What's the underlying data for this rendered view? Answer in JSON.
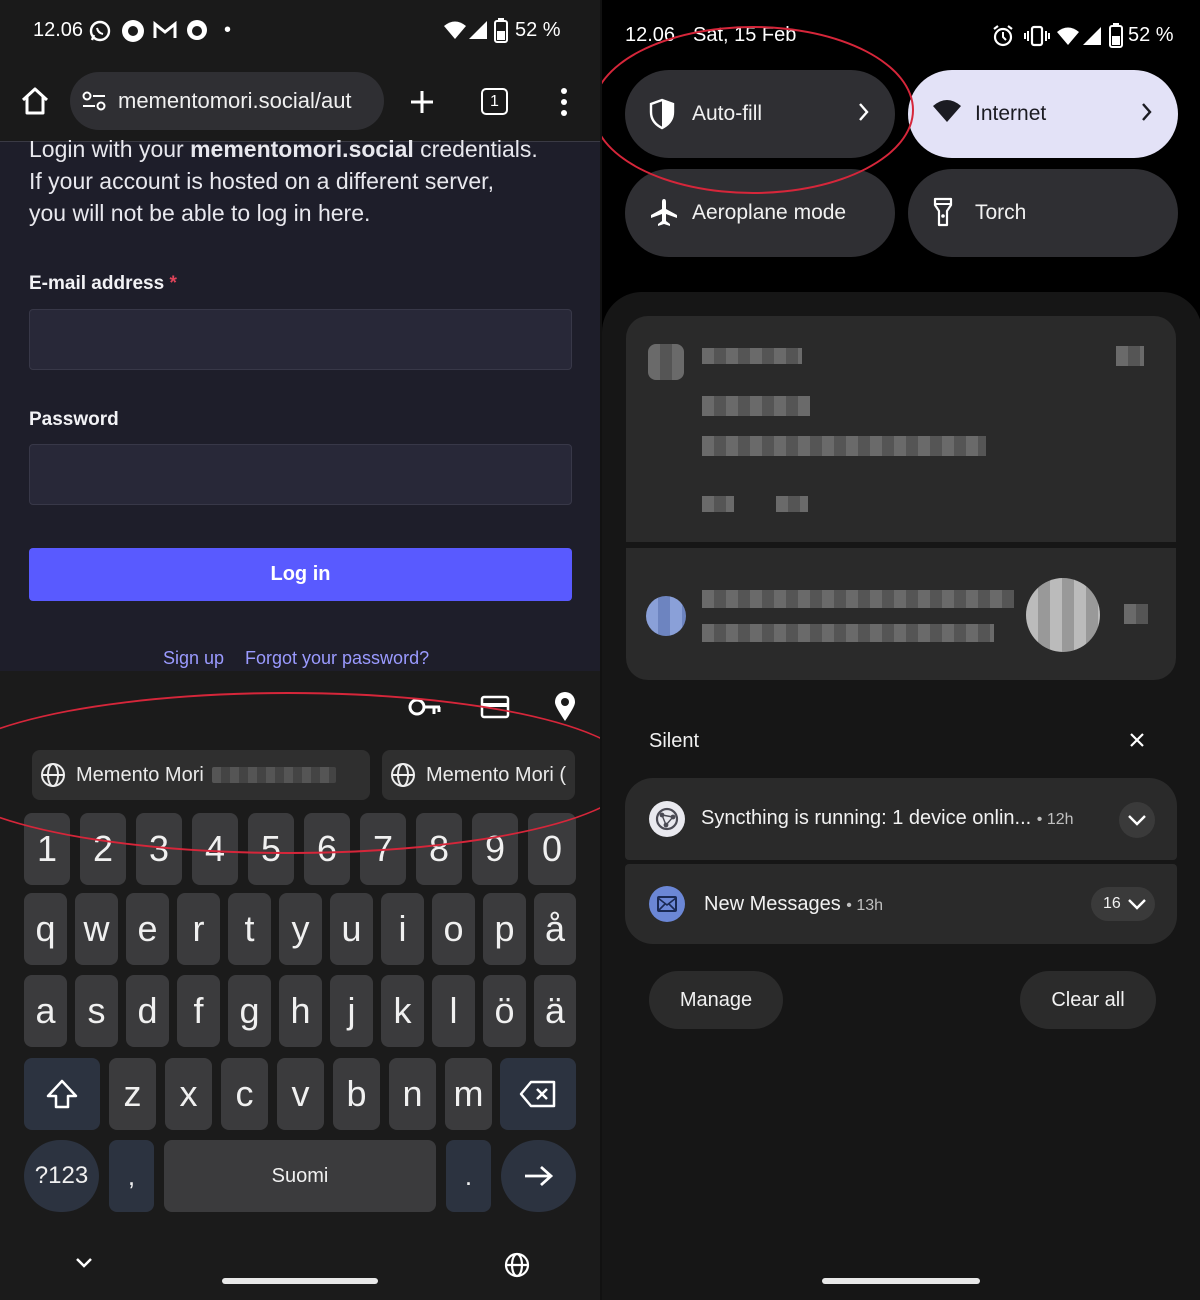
{
  "left": {
    "status": {
      "time": "12.06",
      "dot": "•",
      "battery": "52 %"
    },
    "browser": {
      "url": "mementomori.social/aut",
      "tab_count": "1"
    },
    "page": {
      "intro_line1_pre": "Login with your ",
      "intro_line1_bold": "mementomori.social",
      "intro_line1_post": " credentials.",
      "intro_line2": "If your account is hosted on a different server,",
      "intro_line3": "you will not be able to log in here.",
      "email_label": "E-mail address",
      "required_mark": "*",
      "password_label": "Password",
      "login_button": "Log in",
      "signup_link": "Sign up",
      "forgot_link": "Forgot your password?"
    },
    "keyboard": {
      "suggestion_1": "Memento Mori",
      "suggestion_2": "Memento Mori (",
      "number_row": [
        "1",
        "2",
        "3",
        "4",
        "5",
        "6",
        "7",
        "8",
        "9",
        "0"
      ],
      "row1": [
        "q",
        "w",
        "e",
        "r",
        "t",
        "y",
        "u",
        "i",
        "o",
        "p",
        "å"
      ],
      "row2": [
        "a",
        "s",
        "d",
        "f",
        "g",
        "h",
        "j",
        "k",
        "l",
        "ö",
        "ä"
      ],
      "row3": [
        "z",
        "x",
        "c",
        "v",
        "b",
        "n",
        "m"
      ],
      "symbols_key": "?123",
      "comma_key": ",",
      "space_label": "Suomi",
      "period_key": "."
    }
  },
  "right": {
    "status": {
      "time": "12.06",
      "date": "Sat, 15 Feb",
      "battery": "52 %"
    },
    "tiles": [
      {
        "label": "Auto-fill",
        "icon": "shield-icon",
        "active": false
      },
      {
        "label": "Internet",
        "icon": "wifi-icon",
        "active": true
      },
      {
        "label": "Aeroplane mode",
        "icon": "airplane-icon",
        "active": false
      },
      {
        "label": "Torch",
        "icon": "flashlight-icon",
        "active": false
      }
    ],
    "silent_header": "Silent",
    "notifications": [
      {
        "title": "Syncthing is running: 1 device onlin...",
        "time": "• 12h",
        "icon": "syncthing-icon"
      },
      {
        "title": "New Messages",
        "time": "• 13h",
        "count": "16",
        "icon": "mail-icon"
      }
    ],
    "manage_button": "Manage",
    "clear_all_button": "Clear all"
  },
  "colors": {
    "accent_button": "#595aff",
    "link": "#9a9aff",
    "annotation_circle": "#d6263a",
    "active_tile": "#e3e2f7"
  }
}
